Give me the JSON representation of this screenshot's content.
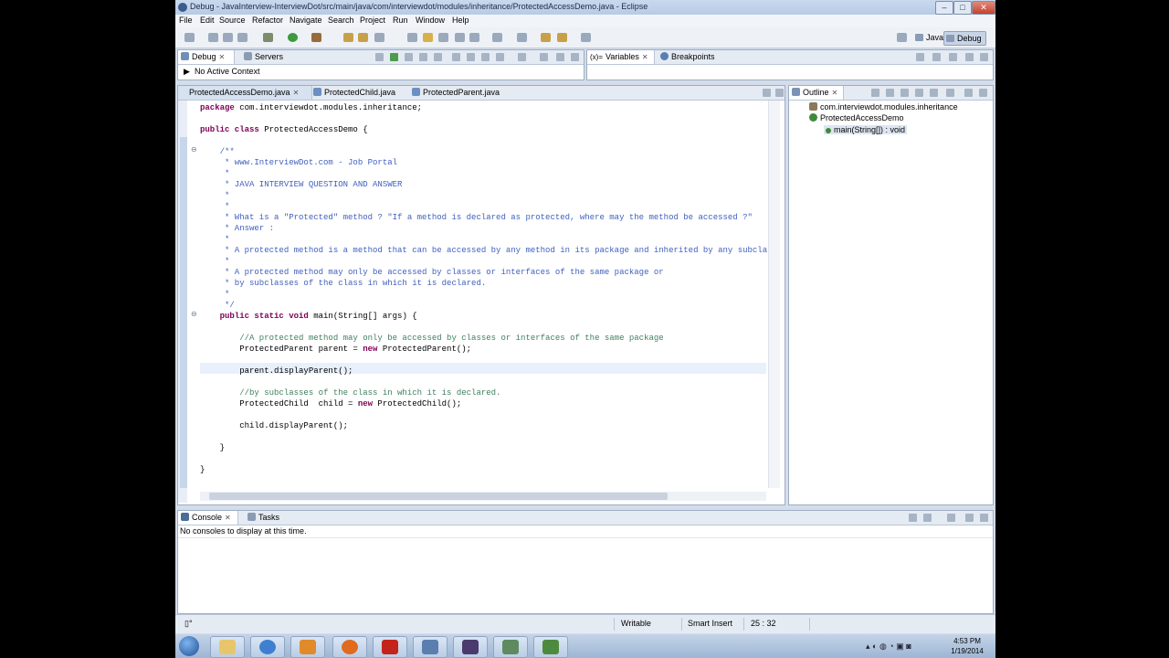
{
  "window": {
    "title": "Debug - JavaInterview-InterviewDot/src/main/java/com/interviewdot/modules/inheritance/ProtectedAccessDemo.java - Eclipse",
    "min": "–",
    "max": "□",
    "close": "✕"
  },
  "menu": [
    "File",
    "Edit",
    "Source",
    "Refactor",
    "Navigate",
    "Search",
    "Project",
    "Run",
    "Window",
    "Help"
  ],
  "perspectives": {
    "java": "Java",
    "debug": "Debug"
  },
  "debug_view": {
    "tabs": [
      "Debug",
      "Servers"
    ],
    "context": "No Active Context"
  },
  "variables_view": {
    "tabs": [
      "Variables",
      "Breakpoints"
    ]
  },
  "editor": {
    "tabs": [
      "ProtectedAccessDemo.java",
      "ProtectedChild.java",
      "ProtectedParent.java"
    ],
    "lines": [
      "package com.interviewdot.modules.inheritance;",
      "",
      "public class ProtectedAccessDemo {",
      "",
      "    /**",
      "     * www.InterviewDot.com - Job Portal",
      "     *",
      "     * JAVA INTERVIEW QUESTION AND ANSWER",
      "     *",
      "     *",
      "     * What is a \"Protected\" method ? \"If a method is declared as protected, where may the method be accessed ?\"",
      "     * Answer :",
      "     *",
      "     * A protected method is a method that can be accessed by any method in its package and inherited by any subclass",
      "     *",
      "     * A protected method may only be accessed by classes or interfaces of the same package or",
      "     * by subclasses of the class in which it is declared.",
      "     *",
      "     */",
      "    public static void main(String[] args) {",
      "",
      "        //A protected method may only be accessed by classes or interfaces of the same package",
      "        ProtectedParent parent = new ProtectedParent();",
      "",
      "        parent.displayParent();",
      "",
      "        //by subclasses of the class in which it is declared.",
      "        ProtectedChild  child = new ProtectedChild();",
      "",
      "        child.displayParent();",
      "",
      "    }",
      "",
      "}"
    ]
  },
  "outline": {
    "tab": "Outline",
    "items": [
      {
        "label": "com.interviewdot.modules.inheritance"
      },
      {
        "label": "ProtectedAccessDemo"
      },
      {
        "label": "main(String[]) : void"
      }
    ]
  },
  "console": {
    "tabs": [
      "Console",
      "Tasks"
    ],
    "message": "No consoles to display at this time."
  },
  "status": {
    "writable": "Writable",
    "insert": "Smart Insert",
    "position": "25 : 32"
  },
  "taskbar": {
    "time": "4:53 PM",
    "date": "1/19/2014"
  }
}
